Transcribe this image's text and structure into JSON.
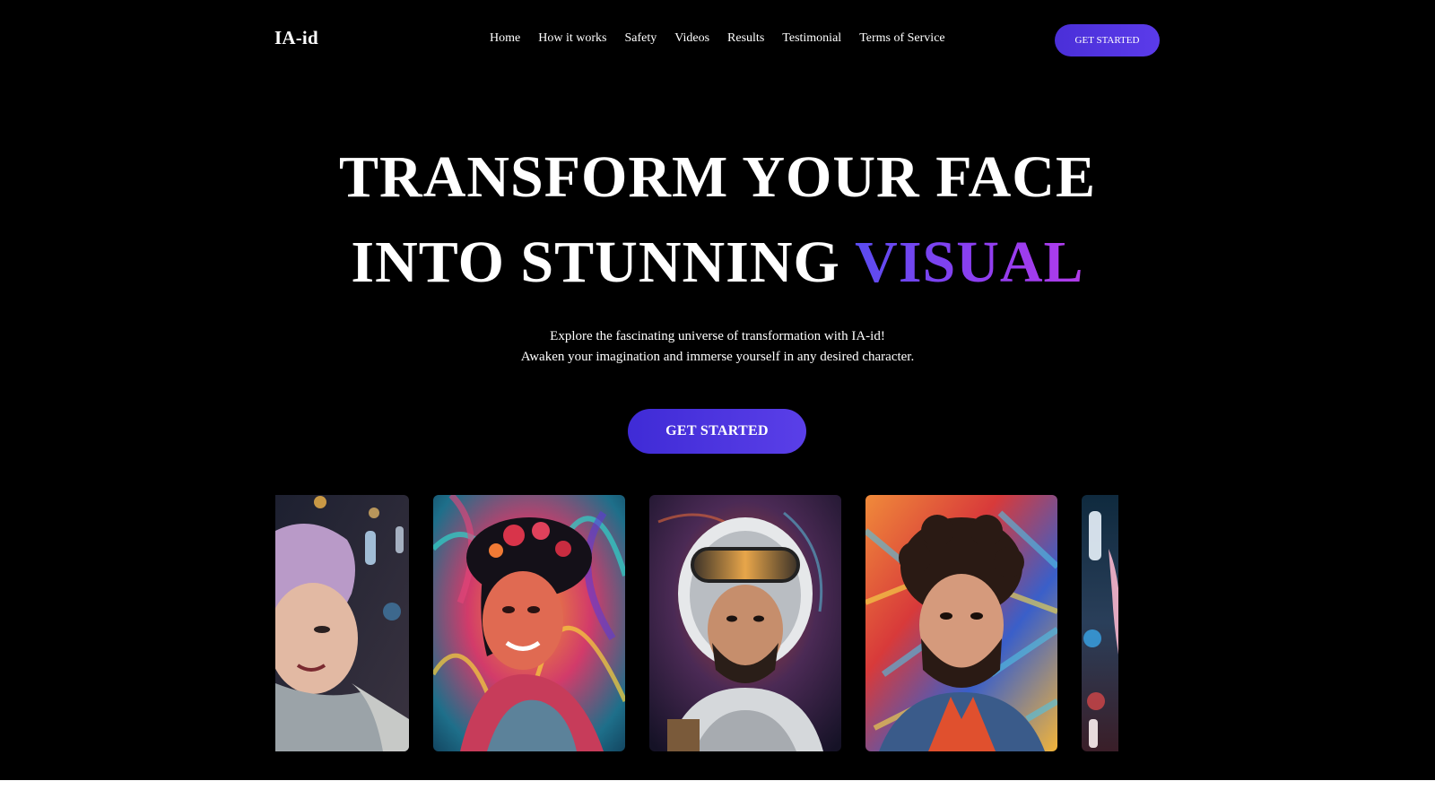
{
  "brand": {
    "logo": "IA-id"
  },
  "nav": {
    "items": [
      "Home",
      "How it works",
      "Safety",
      "Videos",
      "Results",
      "Testimonial",
      "Terms of Service"
    ],
    "cta": "GET STARTED"
  },
  "hero": {
    "line1": "TRANSFORM YOUR FACE",
    "line2_plain": "INTO STUNNING",
    "line2_accent": "VISUAL",
    "sub1": "Explore the fascinating universe of transformation with IA-id!",
    "sub2": "Awaken your imagination and immerse yourself in any desired character.",
    "cta": "GET STARTED"
  },
  "colors": {
    "background": "#000000",
    "accent_start": "#5a4cf0",
    "accent_end": "#b23bea",
    "button": "#4a2fd8"
  }
}
